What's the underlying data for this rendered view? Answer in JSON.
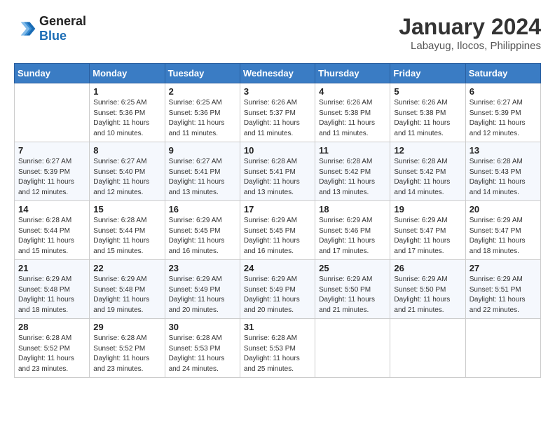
{
  "header": {
    "logo_line1": "General",
    "logo_line2": "Blue",
    "month_year": "January 2024",
    "location": "Labayug, Ilocos, Philippines"
  },
  "weekdays": [
    "Sunday",
    "Monday",
    "Tuesday",
    "Wednesday",
    "Thursday",
    "Friday",
    "Saturday"
  ],
  "weeks": [
    [
      {
        "day": "",
        "sunrise": "",
        "sunset": "",
        "daylight": ""
      },
      {
        "day": "1",
        "sunrise": "Sunrise: 6:25 AM",
        "sunset": "Sunset: 5:36 PM",
        "daylight": "Daylight: 11 hours and 10 minutes."
      },
      {
        "day": "2",
        "sunrise": "Sunrise: 6:25 AM",
        "sunset": "Sunset: 5:36 PM",
        "daylight": "Daylight: 11 hours and 11 minutes."
      },
      {
        "day": "3",
        "sunrise": "Sunrise: 6:26 AM",
        "sunset": "Sunset: 5:37 PM",
        "daylight": "Daylight: 11 hours and 11 minutes."
      },
      {
        "day": "4",
        "sunrise": "Sunrise: 6:26 AM",
        "sunset": "Sunset: 5:38 PM",
        "daylight": "Daylight: 11 hours and 11 minutes."
      },
      {
        "day": "5",
        "sunrise": "Sunrise: 6:26 AM",
        "sunset": "Sunset: 5:38 PM",
        "daylight": "Daylight: 11 hours and 11 minutes."
      },
      {
        "day": "6",
        "sunrise": "Sunrise: 6:27 AM",
        "sunset": "Sunset: 5:39 PM",
        "daylight": "Daylight: 11 hours and 12 minutes."
      }
    ],
    [
      {
        "day": "7",
        "sunrise": "Sunrise: 6:27 AM",
        "sunset": "Sunset: 5:39 PM",
        "daylight": "Daylight: 11 hours and 12 minutes."
      },
      {
        "day": "8",
        "sunrise": "Sunrise: 6:27 AM",
        "sunset": "Sunset: 5:40 PM",
        "daylight": "Daylight: 11 hours and 12 minutes."
      },
      {
        "day": "9",
        "sunrise": "Sunrise: 6:27 AM",
        "sunset": "Sunset: 5:41 PM",
        "daylight": "Daylight: 11 hours and 13 minutes."
      },
      {
        "day": "10",
        "sunrise": "Sunrise: 6:28 AM",
        "sunset": "Sunset: 5:41 PM",
        "daylight": "Daylight: 11 hours and 13 minutes."
      },
      {
        "day": "11",
        "sunrise": "Sunrise: 6:28 AM",
        "sunset": "Sunset: 5:42 PM",
        "daylight": "Daylight: 11 hours and 13 minutes."
      },
      {
        "day": "12",
        "sunrise": "Sunrise: 6:28 AM",
        "sunset": "Sunset: 5:42 PM",
        "daylight": "Daylight: 11 hours and 14 minutes."
      },
      {
        "day": "13",
        "sunrise": "Sunrise: 6:28 AM",
        "sunset": "Sunset: 5:43 PM",
        "daylight": "Daylight: 11 hours and 14 minutes."
      }
    ],
    [
      {
        "day": "14",
        "sunrise": "Sunrise: 6:28 AM",
        "sunset": "Sunset: 5:44 PM",
        "daylight": "Daylight: 11 hours and 15 minutes."
      },
      {
        "day": "15",
        "sunrise": "Sunrise: 6:28 AM",
        "sunset": "Sunset: 5:44 PM",
        "daylight": "Daylight: 11 hours and 15 minutes."
      },
      {
        "day": "16",
        "sunrise": "Sunrise: 6:29 AM",
        "sunset": "Sunset: 5:45 PM",
        "daylight": "Daylight: 11 hours and 16 minutes."
      },
      {
        "day": "17",
        "sunrise": "Sunrise: 6:29 AM",
        "sunset": "Sunset: 5:45 PM",
        "daylight": "Daylight: 11 hours and 16 minutes."
      },
      {
        "day": "18",
        "sunrise": "Sunrise: 6:29 AM",
        "sunset": "Sunset: 5:46 PM",
        "daylight": "Daylight: 11 hours and 17 minutes."
      },
      {
        "day": "19",
        "sunrise": "Sunrise: 6:29 AM",
        "sunset": "Sunset: 5:47 PM",
        "daylight": "Daylight: 11 hours and 17 minutes."
      },
      {
        "day": "20",
        "sunrise": "Sunrise: 6:29 AM",
        "sunset": "Sunset: 5:47 PM",
        "daylight": "Daylight: 11 hours and 18 minutes."
      }
    ],
    [
      {
        "day": "21",
        "sunrise": "Sunrise: 6:29 AM",
        "sunset": "Sunset: 5:48 PM",
        "daylight": "Daylight: 11 hours and 18 minutes."
      },
      {
        "day": "22",
        "sunrise": "Sunrise: 6:29 AM",
        "sunset": "Sunset: 5:48 PM",
        "daylight": "Daylight: 11 hours and 19 minutes."
      },
      {
        "day": "23",
        "sunrise": "Sunrise: 6:29 AM",
        "sunset": "Sunset: 5:49 PM",
        "daylight": "Daylight: 11 hours and 20 minutes."
      },
      {
        "day": "24",
        "sunrise": "Sunrise: 6:29 AM",
        "sunset": "Sunset: 5:49 PM",
        "daylight": "Daylight: 11 hours and 20 minutes."
      },
      {
        "day": "25",
        "sunrise": "Sunrise: 6:29 AM",
        "sunset": "Sunset: 5:50 PM",
        "daylight": "Daylight: 11 hours and 21 minutes."
      },
      {
        "day": "26",
        "sunrise": "Sunrise: 6:29 AM",
        "sunset": "Sunset: 5:50 PM",
        "daylight": "Daylight: 11 hours and 21 minutes."
      },
      {
        "day": "27",
        "sunrise": "Sunrise: 6:29 AM",
        "sunset": "Sunset: 5:51 PM",
        "daylight": "Daylight: 11 hours and 22 minutes."
      }
    ],
    [
      {
        "day": "28",
        "sunrise": "Sunrise: 6:28 AM",
        "sunset": "Sunset: 5:52 PM",
        "daylight": "Daylight: 11 hours and 23 minutes."
      },
      {
        "day": "29",
        "sunrise": "Sunrise: 6:28 AM",
        "sunset": "Sunset: 5:52 PM",
        "daylight": "Daylight: 11 hours and 23 minutes."
      },
      {
        "day": "30",
        "sunrise": "Sunrise: 6:28 AM",
        "sunset": "Sunset: 5:53 PM",
        "daylight": "Daylight: 11 hours and 24 minutes."
      },
      {
        "day": "31",
        "sunrise": "Sunrise: 6:28 AM",
        "sunset": "Sunset: 5:53 PM",
        "daylight": "Daylight: 11 hours and 25 minutes."
      },
      {
        "day": "",
        "sunrise": "",
        "sunset": "",
        "daylight": ""
      },
      {
        "day": "",
        "sunrise": "",
        "sunset": "",
        "daylight": ""
      },
      {
        "day": "",
        "sunrise": "",
        "sunset": "",
        "daylight": ""
      }
    ]
  ]
}
